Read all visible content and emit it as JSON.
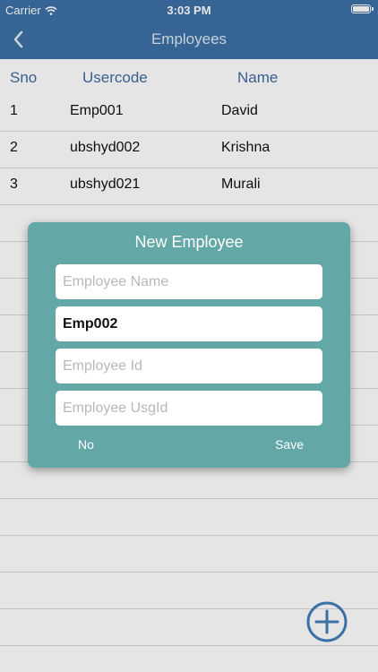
{
  "status_bar": {
    "carrier": "Carrier",
    "time": "3:03 PM"
  },
  "nav": {
    "title": "Employees",
    "back_icon": "chevron-left-icon"
  },
  "table": {
    "headers": [
      "Sno",
      "Usercode",
      "Name"
    ],
    "rows": [
      {
        "sno": "1",
        "code": "Emp001",
        "name": "David"
      },
      {
        "sno": "2",
        "code": "ubshyd002",
        "name": "Krishna"
      },
      {
        "sno": "3",
        "code": "ubshyd021",
        "name": "Murali"
      }
    ]
  },
  "dialog": {
    "title": "New Employee",
    "fields": {
      "name": {
        "placeholder": "Employee Name",
        "value": ""
      },
      "code": {
        "placeholder": "",
        "value": "Emp002"
      },
      "id": {
        "placeholder": "Employee Id",
        "value": ""
      },
      "usg": {
        "placeholder": "Employee UsgId",
        "value": ""
      }
    },
    "no_label": "No",
    "save_label": "Save"
  },
  "fab_icon": "plus-circle-icon",
  "colors": {
    "nav": "#3b70a6",
    "header_text": "#3f6aa0",
    "dialog": "#63a7a7",
    "fab": "#3b70a6"
  }
}
